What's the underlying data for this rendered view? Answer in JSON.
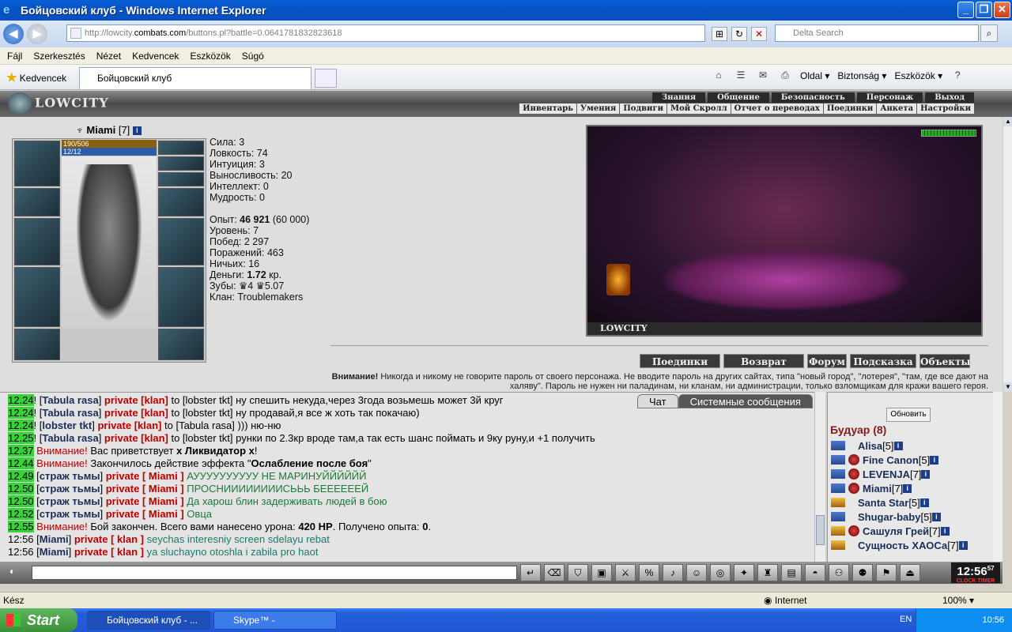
{
  "window": {
    "title": "Бойцовский клуб - Windows Internet Explorer",
    "minimize": "_",
    "maximize": "❐",
    "close": "✕"
  },
  "address": {
    "url_prefix": "http://lowcity.",
    "url_host": "combats.com",
    "url_rest": "/buttons.pl?battle=0.0641781832823618",
    "search_placeholder": "Delta Search"
  },
  "menu": [
    "Fájl",
    "Szerkesztés",
    "Nézet",
    "Kedvencek",
    "Eszközök",
    "Súgó"
  ],
  "favorites": {
    "label": "Kedvencek",
    "tab_title": "Бойцовский клуб",
    "cmd": [
      "Oldal ▾",
      "Biztonság ▾",
      "Eszközök ▾"
    ]
  },
  "game": {
    "logo": "LOWCITY",
    "topnav": [
      "Знания",
      "Общение",
      "Безопасность",
      "Персонаж",
      "Выход"
    ],
    "subnav": [
      "Инвентарь",
      "Умения",
      "Подвиги",
      "Мой Скролл",
      "Отчет о переводах",
      "Поединки",
      "Анкета",
      "Настройки"
    ]
  },
  "character": {
    "name": "Miami",
    "level": "[7]",
    "hp": "190/506",
    "mp": "12/12",
    "stats": [
      "Сила: 3",
      "Ловкость: 74",
      "Интуиция: 3",
      "Выносливость: 20",
      "Интеллект: 0",
      "Мудрость: 0"
    ],
    "exp_label": "Опыт: ",
    "exp_value": "46 921",
    "exp_next": " (60 000)",
    "level_line": "Уровень: 7",
    "wins": "Побед: 2 297",
    "losses": "Поражений: 463",
    "draws": "Ничьих: 16",
    "money_label": "Деньги: ",
    "money_value": "1.72",
    "money_unit": " кр.",
    "teeth": "Зубы: ♛4 ♛5.07",
    "clan": "Клан: Troublemakers"
  },
  "scene": {
    "caption": "LOWCITY",
    "actions": [
      "Поединки",
      "Возврат",
      "Форум",
      "Подсказка",
      "Объекты"
    ],
    "warning_bold": "Внимание!",
    "warning_text": " Никогда и никому не говорите пароль от своего персонажа. Не вводите пароль на других сайтах, типа \"новый город\", \"лотерея\", \"там, где все дают на халяву\". Пароль не нужен ни паладинам, ни кланам, ни администрации, только взломщикам для кражи вашего героя."
  },
  "chat": {
    "tabs": [
      "Чат",
      "Системные сообщения"
    ],
    "lines": [
      {
        "time": "12.24",
        "name": "Tabula rasa",
        "priv": "private [klan]",
        "to": "lobster tkt",
        "text": "ну спешить некуда,через 3года возьмешь может 3й круг"
      },
      {
        "time": "12.24",
        "name": "Tabula rasa",
        "priv": "private [klan]",
        "to": "lobster tkt",
        "text": "ну продавай,я все ж хоть так покачаю)"
      },
      {
        "time": "12.24",
        "name": "lobster tkt",
        "priv": "private [klan]",
        "to": "Tabula rasa",
        "text": "))) ню-ню"
      },
      {
        "time": "12.25",
        "name": "Tabula rasa",
        "priv": "private [klan]",
        "to": "lobster tkt",
        "text": "рунки по 2.3кр вроде там,а так есть шанс поймать и 9ку руну,и +1 получить"
      }
    ],
    "sys1_time": "12.37",
    "sys1_attn": "Внимание!",
    "sys1_pre": " Вас приветствует ",
    "sys1_bold": "x Ликвидатор x",
    "sys1_post": "!",
    "sys2_time": "12.44",
    "sys2_attn": "Внимание!",
    "sys2_pre": " Закончилось действие эффекта \"",
    "sys2_bold": "Ослабление после боя",
    "sys2_post": "\"",
    "guard_lines": [
      {
        "time": "12.49",
        "name": "страж тьмы",
        "priv": "private [ Miami ]",
        "text": "АУУУУУУУУУУ НЕ МАРИНУЙЙЙЙЙЙ"
      },
      {
        "time": "12.50",
        "name": "страж тьмы",
        "priv": "private [ Miami ]",
        "text": "ПРОСНИИИИИИИИСЬЬЬ БЕЕЕЕЕЕЙ"
      },
      {
        "time": "12.50",
        "name": "страж тьмы",
        "priv": "private [ Miami ]",
        "text": "Да харош блин задерживать людей в бою"
      },
      {
        "time": "12.52",
        "name": "страж тьмы",
        "priv": "private [ Miami ]",
        "text": "Овца"
      }
    ],
    "sys3_time": "12.55",
    "sys3_attn": "Внимание!",
    "sys3_pre": " Бой закончен. Всего вами нанесено урона: ",
    "sys3_dmg": "420 HP",
    "sys3_mid": ". Получено опыта: ",
    "sys3_exp": "0",
    "sys3_post": ".",
    "own_lines": [
      {
        "time": "12:56",
        "name": "Miami",
        "priv": "private [ klan ]",
        "text": "seychas interesniy screen sdelayu rebat"
      },
      {
        "time": "12:56",
        "name": "Miami",
        "priv": "private [ klan ]",
        "text": "ya sluchayno otoshla i zabila pro haot"
      }
    ]
  },
  "room": {
    "refresh": "Обновить",
    "title": "Будуар (8)",
    "users": [
      {
        "name": "Alisa",
        "level": "[5]"
      },
      {
        "name": "Fine Canon",
        "level": "[5]"
      },
      {
        "name": "LEVENJA",
        "level": "[7]"
      },
      {
        "name": "Miami",
        "level": "[7]"
      },
      {
        "name": "Santa Star",
        "level": "[5]"
      },
      {
        "name": "Shugar-baby",
        "level": "[5]"
      },
      {
        "name": "Сашуля Грей",
        "level": "[7]"
      },
      {
        "name": "Сущность ХАОСа",
        "level": "[7]"
      }
    ]
  },
  "toolbar": {
    "clock": "12:56",
    "clock_sec": "57",
    "clock_label": "CLOCK  TIMER"
  },
  "status": {
    "left": "Kész",
    "zone": "Internet",
    "zoom": "100% ▾"
  },
  "taskbar": {
    "start": "Start",
    "task1": "Бойцовский клуб - ...",
    "task2": "Skype™ -",
    "lang": "EN",
    "time": "10:56"
  }
}
